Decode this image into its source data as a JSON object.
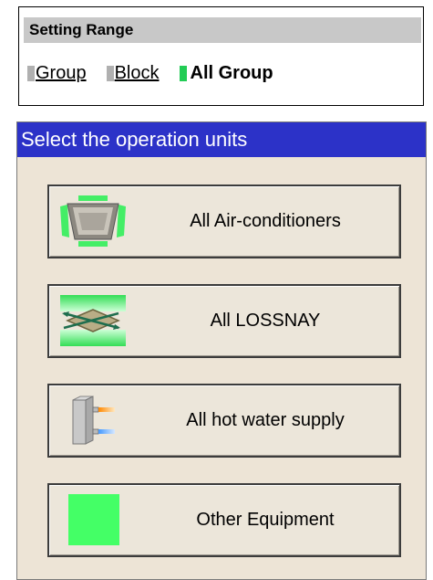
{
  "setting_range": {
    "title": "Setting Range",
    "options": [
      {
        "label": "Group",
        "state": "link"
      },
      {
        "label": "Block",
        "state": "link"
      },
      {
        "label": "All Group",
        "state": "selected"
      }
    ]
  },
  "operation_units": {
    "title": "Select the operation units",
    "buttons": [
      {
        "label": "All Air-conditioners",
        "icon": "air-conditioner-icon"
      },
      {
        "label": "All LOSSNAY",
        "icon": "lossnay-icon"
      },
      {
        "label": "All hot water supply",
        "icon": "hot-water-supply-icon"
      },
      {
        "label": "Other Equipment",
        "icon": "other-equipment-icon"
      }
    ]
  },
  "colors": {
    "title_bar": "#2c32c8",
    "panel_bg": "#ede4d6",
    "selected_marker": "#22cc55",
    "range_header_bg": "#c8c8c8"
  }
}
